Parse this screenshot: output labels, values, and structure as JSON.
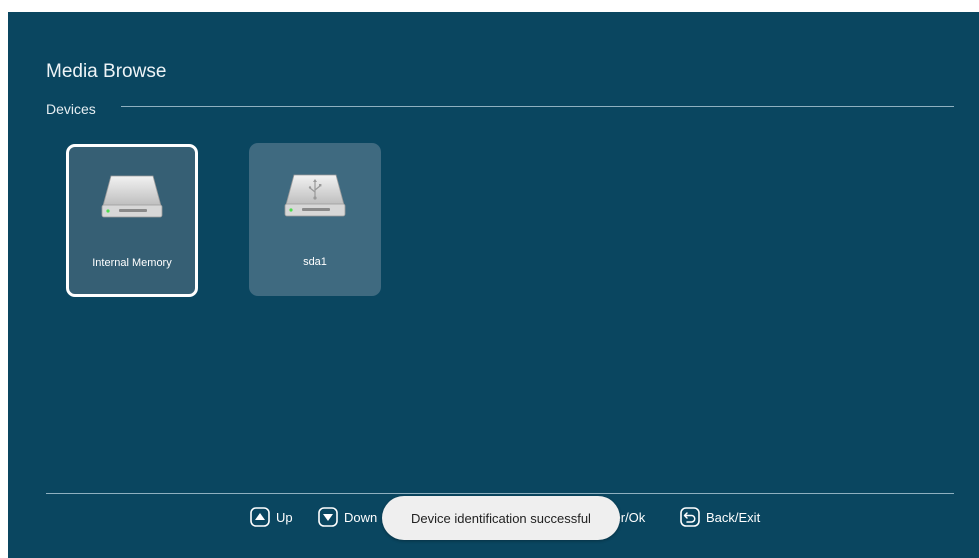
{
  "header": {
    "title": "Media Browse",
    "section_label": "Devices"
  },
  "devices": [
    {
      "label": "Internal Memory",
      "icon": "hard-drive-icon",
      "selected": true
    },
    {
      "label": "sda1",
      "icon": "usb-drive-icon",
      "selected": false
    }
  ],
  "footer": {
    "hints": [
      {
        "label": "Up",
        "icon": "up-arrow-icon"
      },
      {
        "label": "Down",
        "icon": "down-arrow-icon"
      },
      {
        "label": "Enter/Ok",
        "icon": "enter-ok-icon"
      },
      {
        "label": "Back/Exit",
        "icon": "back-icon"
      }
    ]
  },
  "toast": {
    "message": "Device identification successful"
  },
  "colors": {
    "background": "#0a4660",
    "tile": "#3f6a80",
    "selected_border": "#ffffff",
    "toast_background": "#efefef"
  }
}
